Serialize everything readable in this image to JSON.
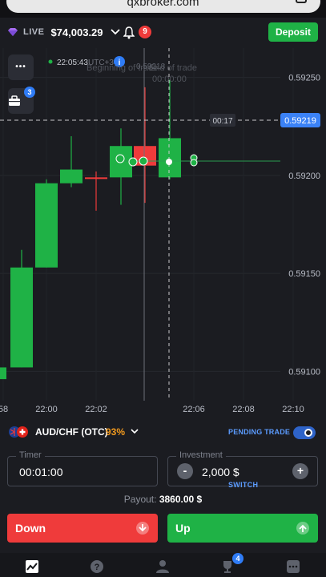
{
  "browser": {
    "url": "qxbroker.com"
  },
  "account": {
    "mode": "LIVE",
    "balance": "$74,003.29",
    "notifications": "9",
    "deposit_label": "Deposit"
  },
  "sidebar": {
    "menu_glyph": "•••",
    "portfolio_badge": "3"
  },
  "chart": {
    "clock": "22:05:43",
    "timezone": "UTC+3",
    "trade_label": "Beginning of trade",
    "trade_label_end": "End of trade",
    "trade_time": "00:00:00",
    "trade_value": "0.59218",
    "countdown": "00:17",
    "current_price": "0.59219",
    "price_labels": [
      "0.59250",
      "0.59200",
      "0.59150",
      "0.59100"
    ],
    "time_labels": [
      "58",
      "22:00",
      "22:02",
      "22:06",
      "22:08",
      "22:10"
    ],
    "colors": {
      "up": "#1fb246",
      "down": "#ef3b3b",
      "price_tag": "#3b82f6"
    }
  },
  "chart_data": {
    "type": "candlestick",
    "title": "",
    "symbol": "AUD/CHF (OTC)",
    "ylim": [
      0.59085,
      0.59265
    ],
    "candles": [
      {
        "t": "21:59",
        "o": 0.59096,
        "h": 0.59112,
        "l": 0.5909,
        "c": 0.59102,
        "dir": "up"
      },
      {
        "t": "22:00",
        "o": 0.59102,
        "h": 0.59162,
        "l": 0.59102,
        "c": 0.59153,
        "dir": "up"
      },
      {
        "t": "22:00:30",
        "o": 0.59153,
        "h": 0.59198,
        "l": 0.59153,
        "c": 0.59196,
        "dir": "up"
      },
      {
        "t": "22:01",
        "o": 0.59196,
        "h": 0.5922,
        "l": 0.59194,
        "c": 0.59203,
        "dir": "up"
      },
      {
        "t": "22:01:30",
        "o": 0.59199,
        "h": 0.59202,
        "l": 0.59182,
        "c": 0.59199,
        "dir": "down"
      },
      {
        "t": "22:02",
        "o": 0.59199,
        "h": 0.59224,
        "l": 0.59185,
        "c": 0.59215,
        "dir": "up"
      },
      {
        "t": "22:02:30",
        "o": 0.59215,
        "h": 0.59245,
        "l": 0.59186,
        "c": 0.59205,
        "dir": "down"
      },
      {
        "t": "22:03",
        "o": 0.59199,
        "h": 0.59249,
        "l": 0.59198,
        "c": 0.59219,
        "dir": "up"
      }
    ]
  },
  "asset": {
    "pair": "AUD/CHF (OTC)",
    "payout_pct": "93%",
    "pending_label": "PENDING TRADE"
  },
  "timer": {
    "label": "Timer",
    "value": "00:01:00"
  },
  "investment": {
    "label": "Investment",
    "value": "2,000 $",
    "minus": "-",
    "plus": "+",
    "switch_label": "SWITCH"
  },
  "payout": {
    "label": "Payout:",
    "value": "3860.00 $"
  },
  "actions": {
    "down_label": "Down",
    "up_label": "Up"
  },
  "nav": {
    "tournament_badge": "4"
  }
}
